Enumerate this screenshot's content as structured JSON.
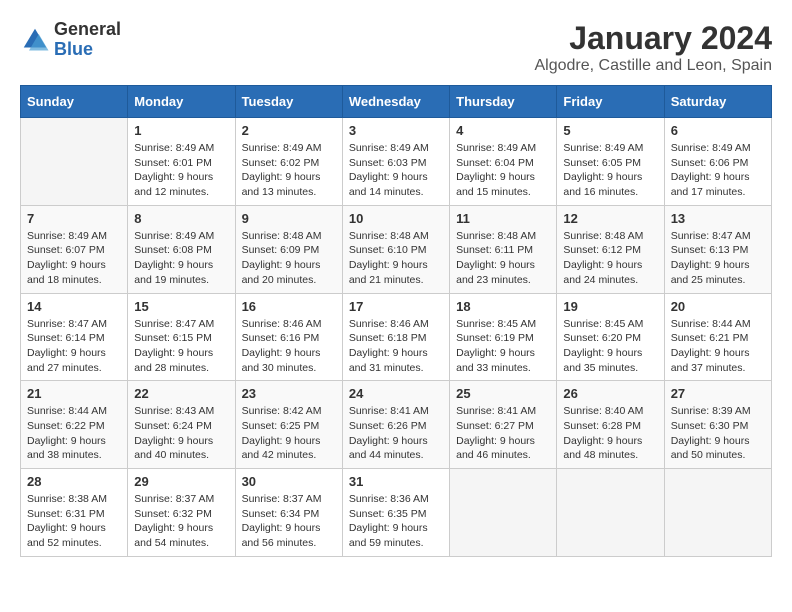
{
  "header": {
    "logo_general": "General",
    "logo_blue": "Blue",
    "title": "January 2024",
    "subtitle": "Algodre, Castille and Leon, Spain"
  },
  "days_of_week": [
    "Sunday",
    "Monday",
    "Tuesday",
    "Wednesday",
    "Thursday",
    "Friday",
    "Saturday"
  ],
  "weeks": [
    [
      {
        "day": "",
        "sunrise": "",
        "sunset": "",
        "daylight": ""
      },
      {
        "day": "1",
        "sunrise": "Sunrise: 8:49 AM",
        "sunset": "Sunset: 6:01 PM",
        "daylight": "Daylight: 9 hours and 12 minutes."
      },
      {
        "day": "2",
        "sunrise": "Sunrise: 8:49 AM",
        "sunset": "Sunset: 6:02 PM",
        "daylight": "Daylight: 9 hours and 13 minutes."
      },
      {
        "day": "3",
        "sunrise": "Sunrise: 8:49 AM",
        "sunset": "Sunset: 6:03 PM",
        "daylight": "Daylight: 9 hours and 14 minutes."
      },
      {
        "day": "4",
        "sunrise": "Sunrise: 8:49 AM",
        "sunset": "Sunset: 6:04 PM",
        "daylight": "Daylight: 9 hours and 15 minutes."
      },
      {
        "day": "5",
        "sunrise": "Sunrise: 8:49 AM",
        "sunset": "Sunset: 6:05 PM",
        "daylight": "Daylight: 9 hours and 16 minutes."
      },
      {
        "day": "6",
        "sunrise": "Sunrise: 8:49 AM",
        "sunset": "Sunset: 6:06 PM",
        "daylight": "Daylight: 9 hours and 17 minutes."
      }
    ],
    [
      {
        "day": "7",
        "sunrise": "Sunrise: 8:49 AM",
        "sunset": "Sunset: 6:07 PM",
        "daylight": "Daylight: 9 hours and 18 minutes."
      },
      {
        "day": "8",
        "sunrise": "Sunrise: 8:49 AM",
        "sunset": "Sunset: 6:08 PM",
        "daylight": "Daylight: 9 hours and 19 minutes."
      },
      {
        "day": "9",
        "sunrise": "Sunrise: 8:48 AM",
        "sunset": "Sunset: 6:09 PM",
        "daylight": "Daylight: 9 hours and 20 minutes."
      },
      {
        "day": "10",
        "sunrise": "Sunrise: 8:48 AM",
        "sunset": "Sunset: 6:10 PM",
        "daylight": "Daylight: 9 hours and 21 minutes."
      },
      {
        "day": "11",
        "sunrise": "Sunrise: 8:48 AM",
        "sunset": "Sunset: 6:11 PM",
        "daylight": "Daylight: 9 hours and 23 minutes."
      },
      {
        "day": "12",
        "sunrise": "Sunrise: 8:48 AM",
        "sunset": "Sunset: 6:12 PM",
        "daylight": "Daylight: 9 hours and 24 minutes."
      },
      {
        "day": "13",
        "sunrise": "Sunrise: 8:47 AM",
        "sunset": "Sunset: 6:13 PM",
        "daylight": "Daylight: 9 hours and 25 minutes."
      }
    ],
    [
      {
        "day": "14",
        "sunrise": "Sunrise: 8:47 AM",
        "sunset": "Sunset: 6:14 PM",
        "daylight": "Daylight: 9 hours and 27 minutes."
      },
      {
        "day": "15",
        "sunrise": "Sunrise: 8:47 AM",
        "sunset": "Sunset: 6:15 PM",
        "daylight": "Daylight: 9 hours and 28 minutes."
      },
      {
        "day": "16",
        "sunrise": "Sunrise: 8:46 AM",
        "sunset": "Sunset: 6:16 PM",
        "daylight": "Daylight: 9 hours and 30 minutes."
      },
      {
        "day": "17",
        "sunrise": "Sunrise: 8:46 AM",
        "sunset": "Sunset: 6:18 PM",
        "daylight": "Daylight: 9 hours and 31 minutes."
      },
      {
        "day": "18",
        "sunrise": "Sunrise: 8:45 AM",
        "sunset": "Sunset: 6:19 PM",
        "daylight": "Daylight: 9 hours and 33 minutes."
      },
      {
        "day": "19",
        "sunrise": "Sunrise: 8:45 AM",
        "sunset": "Sunset: 6:20 PM",
        "daylight": "Daylight: 9 hours and 35 minutes."
      },
      {
        "day": "20",
        "sunrise": "Sunrise: 8:44 AM",
        "sunset": "Sunset: 6:21 PM",
        "daylight": "Daylight: 9 hours and 37 minutes."
      }
    ],
    [
      {
        "day": "21",
        "sunrise": "Sunrise: 8:44 AM",
        "sunset": "Sunset: 6:22 PM",
        "daylight": "Daylight: 9 hours and 38 minutes."
      },
      {
        "day": "22",
        "sunrise": "Sunrise: 8:43 AM",
        "sunset": "Sunset: 6:24 PM",
        "daylight": "Daylight: 9 hours and 40 minutes."
      },
      {
        "day": "23",
        "sunrise": "Sunrise: 8:42 AM",
        "sunset": "Sunset: 6:25 PM",
        "daylight": "Daylight: 9 hours and 42 minutes."
      },
      {
        "day": "24",
        "sunrise": "Sunrise: 8:41 AM",
        "sunset": "Sunset: 6:26 PM",
        "daylight": "Daylight: 9 hours and 44 minutes."
      },
      {
        "day": "25",
        "sunrise": "Sunrise: 8:41 AM",
        "sunset": "Sunset: 6:27 PM",
        "daylight": "Daylight: 9 hours and 46 minutes."
      },
      {
        "day": "26",
        "sunrise": "Sunrise: 8:40 AM",
        "sunset": "Sunset: 6:28 PM",
        "daylight": "Daylight: 9 hours and 48 minutes."
      },
      {
        "day": "27",
        "sunrise": "Sunrise: 8:39 AM",
        "sunset": "Sunset: 6:30 PM",
        "daylight": "Daylight: 9 hours and 50 minutes."
      }
    ],
    [
      {
        "day": "28",
        "sunrise": "Sunrise: 8:38 AM",
        "sunset": "Sunset: 6:31 PM",
        "daylight": "Daylight: 9 hours and 52 minutes."
      },
      {
        "day": "29",
        "sunrise": "Sunrise: 8:37 AM",
        "sunset": "Sunset: 6:32 PM",
        "daylight": "Daylight: 9 hours and 54 minutes."
      },
      {
        "day": "30",
        "sunrise": "Sunrise: 8:37 AM",
        "sunset": "Sunset: 6:34 PM",
        "daylight": "Daylight: 9 hours and 56 minutes."
      },
      {
        "day": "31",
        "sunrise": "Sunrise: 8:36 AM",
        "sunset": "Sunset: 6:35 PM",
        "daylight": "Daylight: 9 hours and 59 minutes."
      },
      {
        "day": "",
        "sunrise": "",
        "sunset": "",
        "daylight": ""
      },
      {
        "day": "",
        "sunrise": "",
        "sunset": "",
        "daylight": ""
      },
      {
        "day": "",
        "sunrise": "",
        "sunset": "",
        "daylight": ""
      }
    ]
  ]
}
